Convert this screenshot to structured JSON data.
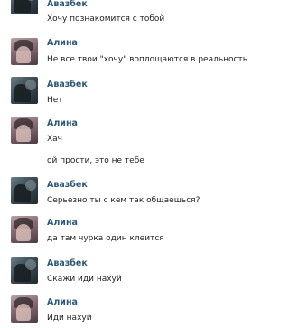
{
  "messages": [
    {
      "author": "Авазбек",
      "avatar": "avatar-azabek",
      "lines": [
        "Хочу познакомится с тобой"
      ]
    },
    {
      "author": "Алина",
      "avatar": "avatar-alina",
      "lines": [
        "Не все твои \"хочу\" воплощаются в реальность"
      ]
    },
    {
      "author": "Авазбек",
      "avatar": "avatar-azabek",
      "lines": [
        "Нет"
      ]
    },
    {
      "author": "Алина",
      "avatar": "avatar-alina",
      "lines": [
        "Хач",
        "ой прости, это не тебе"
      ]
    },
    {
      "author": "Авазбек",
      "avatar": "avatar-azabek",
      "lines": [
        "Серьезно ты с кем так общаешься?"
      ]
    },
    {
      "author": "Алина",
      "avatar": "avatar-alina",
      "lines": [
        "да там чурка один клеится"
      ]
    },
    {
      "author": "Авазбек",
      "avatar": "avatar-azabek",
      "lines": [
        "Скажи иди нахуй"
      ]
    },
    {
      "author": "Алина",
      "avatar": "avatar-alina",
      "lines": [
        "Иди нахуй"
      ]
    }
  ]
}
